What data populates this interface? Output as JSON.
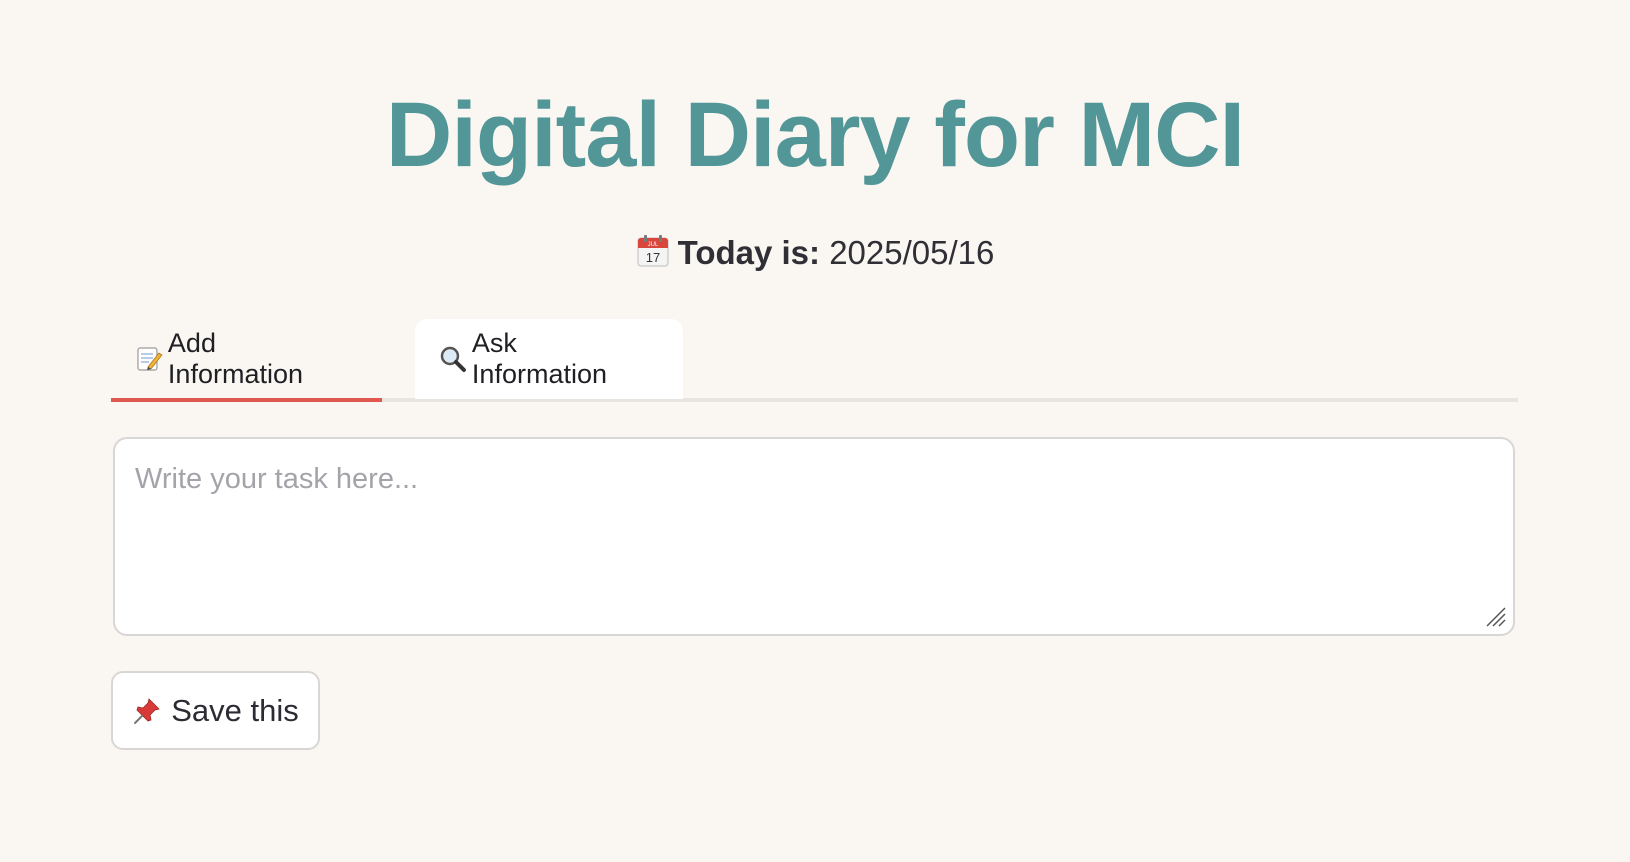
{
  "header": {
    "title": "Digital Diary for MCI",
    "date_label": "Today is:",
    "date_value": "2025/05/16",
    "date_icon": "calendar-icon",
    "calendar_icon_text": {
      "month": "JUL",
      "day": "17"
    }
  },
  "tabs": [
    {
      "label": "Add Information",
      "icon": "memo-icon",
      "active": true
    },
    {
      "label": "Ask Information",
      "icon": "magnifier-icon",
      "active": false
    }
  ],
  "task_input": {
    "placeholder": "Write your task here...",
    "value": ""
  },
  "save_button": {
    "label": "Save this",
    "icon": "pushpin-icon"
  },
  "colors": {
    "background": "#faf7f3",
    "title": "#529698",
    "active_tab_underline": "#e0584f",
    "tab_track": "#e8e4e0"
  }
}
